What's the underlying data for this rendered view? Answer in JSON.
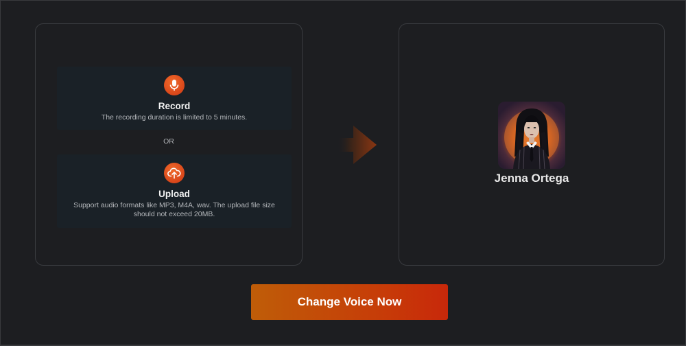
{
  "input": {
    "record": {
      "title": "Record",
      "description": "The recording duration is limited to 5 minutes.",
      "icon": "microphone-icon"
    },
    "separator": "OR",
    "upload": {
      "title": "Upload",
      "description": "Support audio formats like MP3, M4A, wav. The upload file size should not exceed 20MB.",
      "icon": "upload-cloud-icon"
    }
  },
  "flow_arrow_icon": "arrow-right-icon",
  "target_voice": {
    "name": "Jenna Ortega",
    "avatar": "avatar-portrait"
  },
  "action": {
    "label": "Change Voice Now"
  },
  "colors": {
    "accent": "#e0501e",
    "button_start": "#bf5d08",
    "button_end": "#c8280a",
    "background": "#1d1e21",
    "card": "#1a2127"
  }
}
